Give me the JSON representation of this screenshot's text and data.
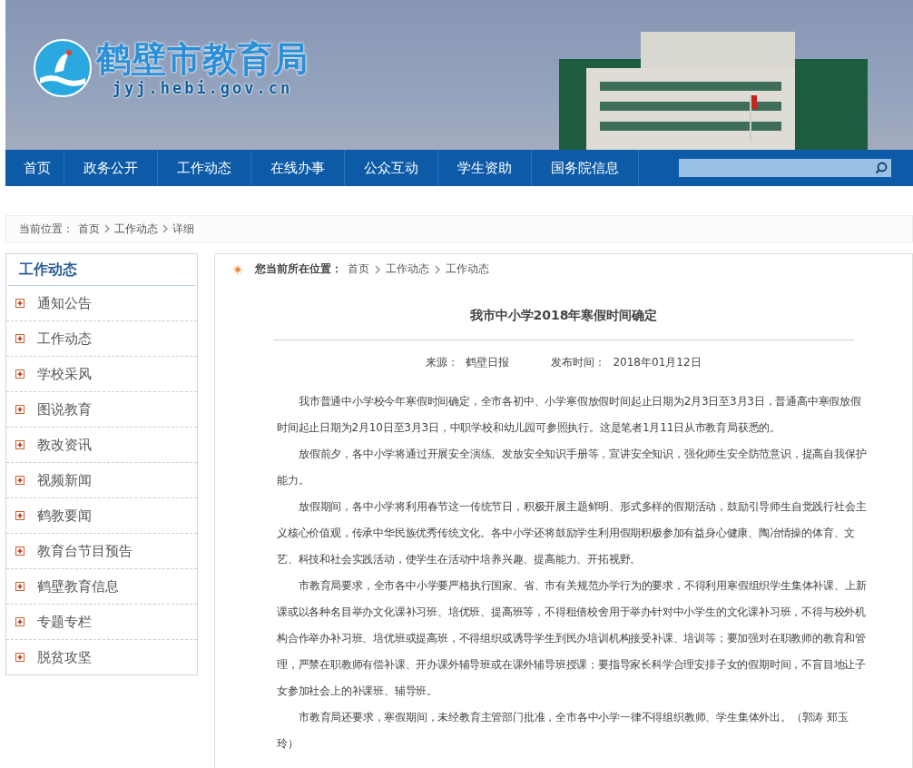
{
  "header": {
    "site_name": "鹤壁市教育局",
    "domain": "jyj.hebi.gov.cn"
  },
  "nav": {
    "items": [
      "首页",
      "政务公开",
      "工作动态",
      "在线办事",
      "公众互动",
      "学生资助",
      "国务院信息"
    ]
  },
  "location_bar": {
    "label": "当前位置：",
    "crumbs": [
      "首页",
      "工作动态",
      "详细"
    ]
  },
  "sidebar": {
    "title": "工作动态",
    "items": [
      "通知公告",
      "工作动态",
      "学校采风",
      "图说教育",
      "教改资讯",
      "视频新闻",
      "鹤教要闻",
      "教育台节目预告",
      "鹤壁教育信息",
      "专题专栏",
      "脱贫攻坚"
    ]
  },
  "article": {
    "location_label": "您当前所在位置：",
    "crumbs": [
      "首页",
      "工作动态",
      "工作动态"
    ],
    "title": "我市中小学2018年寒假时间确定",
    "source_label": "来源：",
    "source": "鹤壁日报",
    "date_label": "发布时间：",
    "date": "2018年01月12日",
    "paragraphs": [
      "我市普通中小学校今年寒假时间确定，全市各初中、小学寒假放假时间起止日期为2月3日至3月3日，普通高中寒假放假时间起止日期为2月10日至3月3日，中职学校和幼儿园可参照执行。这是笔者1月11日从市教育局获悉的。",
      "放假前夕，各中小学将通过开展安全演练、发放安全知识手册等，宣讲安全知识，强化师生安全防范意识，提高自我保护能力。",
      "放假期间，各中小学将利用春节这一传统节日，积极开展主题鲜明、形式多样的假期活动，鼓励引导师生自觉践行社会主义核心价值观，传承中华民族优秀传统文化。各中小学还将鼓励学生利用假期积极参加有益身心健康、陶冶情操的体育、文艺、科技和社会实践活动，使学生在活动中培养兴趣、提高能力、开拓视野。",
      "市教育局要求，全市各中小学要严格执行国家、省、市有关规范办学行为的要求，不得利用寒假组织学生集体补课、上新课或以各种名目举办文化课补习班、培优班、提高班等，不得租借校舍用于举办针对中小学生的文化课补习班，不得与校外机构合作举办补习班、培优班或提高班，不得组织或诱导学生到民办培训机构接受补课、培训等；要加强对在职教师的教育和管理，严禁在职教师有偿补课、开办课外辅导班或在课外辅导班授课；要指导家长科学合理安排子女的假期时间，不盲目地让子女参加社会上的补课班、辅导班。",
      "市教育局还要求，寒假期间，未经教育主管部门批准，全市各中小学一律不得组织教师、学生集体外出。（郭涛 郑玉玲）"
    ]
  }
}
